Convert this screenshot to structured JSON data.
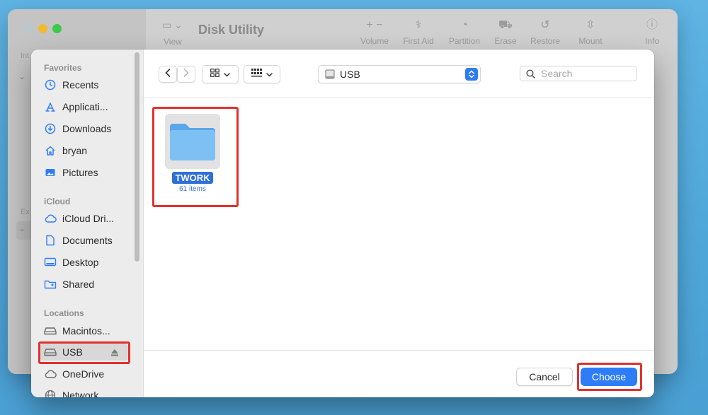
{
  "background_window": {
    "title": "Disk Utility",
    "view_label": "View",
    "toolbar": [
      {
        "label": "Volume",
        "glyph": "+ −"
      },
      {
        "label": "First Aid",
        "glyph": "⚕"
      },
      {
        "label": "Partition",
        "glyph": "◔"
      },
      {
        "label": "Erase",
        "glyph": "⛟"
      },
      {
        "label": "Restore",
        "glyph": "↺"
      },
      {
        "label": "Mount",
        "glyph": "⇳"
      },
      {
        "label": "Info",
        "glyph": "ⓘ"
      }
    ],
    "sidebar_labels": [
      "Int",
      "Ex"
    ]
  },
  "dialog": {
    "sidebar": {
      "favorites_title": "Favorites",
      "favorites": [
        {
          "label": "Recents",
          "icon": "clock-icon"
        },
        {
          "label": "Applicati...",
          "icon": "apps-icon"
        },
        {
          "label": "Downloads",
          "icon": "download-icon"
        },
        {
          "label": "bryan",
          "icon": "home-icon"
        },
        {
          "label": "Pictures",
          "icon": "photo-icon"
        }
      ],
      "icloud_title": "iCloud",
      "icloud": [
        {
          "label": "iCloud Dri...",
          "icon": "cloud-icon"
        },
        {
          "label": "Documents",
          "icon": "document-icon"
        },
        {
          "label": "Desktop",
          "icon": "desktop-icon"
        },
        {
          "label": "Shared",
          "icon": "shared-folder-icon"
        }
      ],
      "locations_title": "Locations",
      "locations": [
        {
          "label": "Macintos...",
          "icon": "drive-icon"
        },
        {
          "label": "USB",
          "icon": "drive-icon",
          "selected": true
        },
        {
          "label": "OneDrive",
          "icon": "cloud-icon"
        },
        {
          "label": "Network",
          "icon": "globe-icon"
        }
      ]
    },
    "toolbar": {
      "location": "USB",
      "search_placeholder": "Search"
    },
    "files": [
      {
        "name": "TWORK",
        "count": "61 items"
      }
    ],
    "buttons": {
      "cancel": "Cancel",
      "choose": "Choose"
    },
    "colors": {
      "accent": "#2f7df6",
      "highlight": "#e0312f"
    }
  }
}
